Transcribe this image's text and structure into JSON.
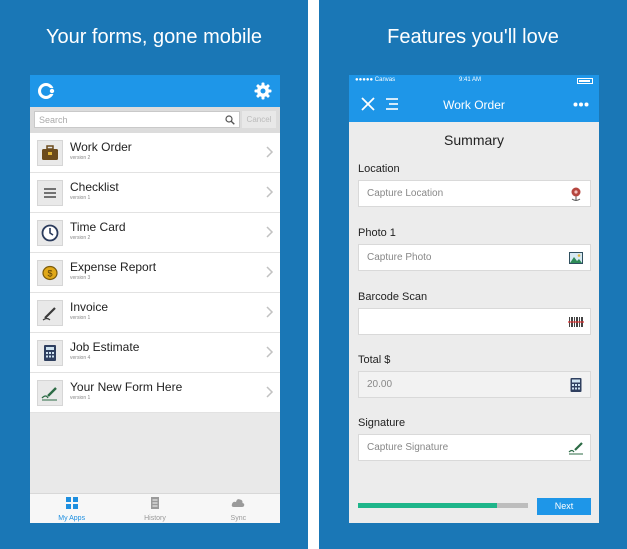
{
  "left": {
    "headline": "Your forms, gone mobile",
    "search": {
      "placeholder": "Search",
      "cancel_label": "Cancel"
    },
    "forms": [
      {
        "title": "Work Order",
        "version": "version 2",
        "icon": "briefcase-icon"
      },
      {
        "title": "Checklist",
        "version": "version 1",
        "icon": "checklist-icon"
      },
      {
        "title": "Time Card",
        "version": "version 2",
        "icon": "clock-icon"
      },
      {
        "title": "Expense Report",
        "version": "version 3",
        "icon": "coin-icon"
      },
      {
        "title": "Invoice",
        "version": "version 1",
        "icon": "pen-icon"
      },
      {
        "title": "Job Estimate",
        "version": "version 4",
        "icon": "calculator-icon"
      },
      {
        "title": "Your New Form Here",
        "version": "version 1",
        "icon": "signature-icon"
      }
    ],
    "tabs": [
      {
        "label": "My Apps",
        "icon": "grid-icon",
        "active": true
      },
      {
        "label": "History",
        "icon": "history-icon",
        "active": false
      },
      {
        "label": "Sync",
        "icon": "cloud-icon",
        "active": false
      }
    ]
  },
  "right": {
    "headline": "Features you'll love",
    "status": {
      "carrier": "●●●●● Canvas",
      "time": "9:41 AM"
    },
    "nav_title": "Work Order",
    "summary_title": "Summary",
    "fields": [
      {
        "label": "Location",
        "value": "Capture Location",
        "icon": "map-pin-icon"
      },
      {
        "label": "Photo 1",
        "value": "Capture Photo",
        "icon": "image-icon"
      },
      {
        "label": "Barcode Scan",
        "value": "",
        "icon": "barcode-icon"
      },
      {
        "label": "Total $",
        "value": "20.00",
        "icon": "calculator-icon"
      },
      {
        "label": "Signature",
        "value": "Capture Signature",
        "icon": "signature-icon"
      }
    ],
    "progress": 0.82,
    "next_label": "Next"
  },
  "colors": {
    "brand_blue": "#1a77b6",
    "app_blue": "#1e96e8",
    "progress_green": "#1eb58a"
  }
}
